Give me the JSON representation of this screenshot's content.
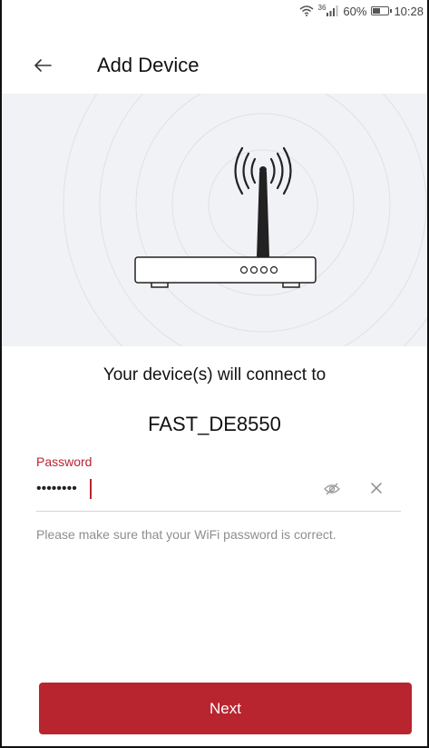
{
  "status_bar": {
    "network": "36",
    "battery": "60%",
    "time": "10:28",
    "battery_level": 0.6
  },
  "header": {
    "title": "Add Device",
    "back_icon": "arrow-left-icon"
  },
  "hero": {
    "illustration": "router-broadcast-illustration"
  },
  "message": "Your device(s) will connect to",
  "network_name": "FAST_DE8550",
  "password_field": {
    "label": "Password",
    "value": "12345678",
    "eye_icon": "eye-slash-icon",
    "clear_icon": "close-icon"
  },
  "hint": "Please make sure that your WiFi password is correct.",
  "next_label": "Next",
  "colors": {
    "accent": "#b8252f",
    "hero_bg": "#f1f2f5",
    "hint_text": "#8e8e8e"
  }
}
